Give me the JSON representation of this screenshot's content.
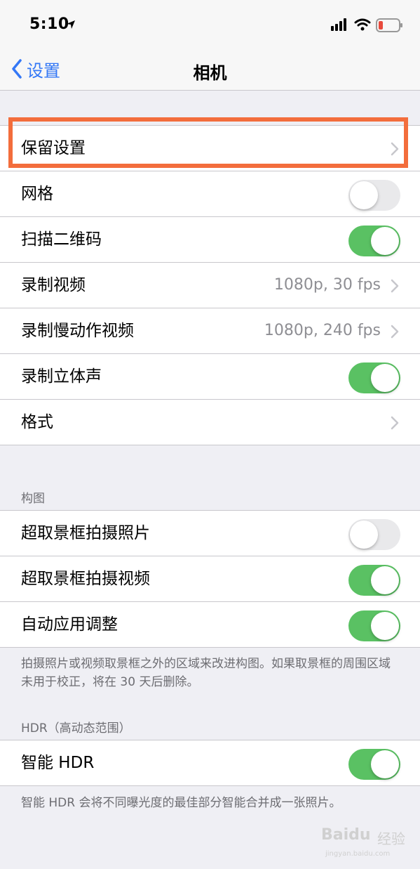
{
  "status_bar": {
    "time": "5:10"
  },
  "nav": {
    "back_label": "设置",
    "title": "相机"
  },
  "group1": {
    "rows": [
      {
        "label": "保留设置",
        "type": "link"
      },
      {
        "label": "网格",
        "type": "toggle",
        "on": false
      },
      {
        "label": "扫描二维码",
        "type": "toggle",
        "on": true
      },
      {
        "label": "录制视频",
        "type": "link",
        "value": "1080p, 30 fps"
      },
      {
        "label": "录制慢动作视频",
        "type": "link",
        "value": "1080p, 240 fps"
      },
      {
        "label": "录制立体声",
        "type": "toggle",
        "on": true
      },
      {
        "label": "格式",
        "type": "link"
      }
    ]
  },
  "composition": {
    "header": "构图",
    "rows": [
      {
        "label": "超取景框拍摄照片",
        "type": "toggle",
        "on": false
      },
      {
        "label": "超取景框拍摄视频",
        "type": "toggle",
        "on": true
      },
      {
        "label": "自动应用调整",
        "type": "toggle",
        "on": true
      }
    ],
    "footer": "拍摄照片或视频取景框之外的区域来改进构图。如果取景框的周围区域未用于校正，将在 30 天后删除。"
  },
  "hdr": {
    "header": "HDR（高动态范围）",
    "rows": [
      {
        "label": "智能 HDR",
        "type": "toggle",
        "on": true
      }
    ],
    "footer": "智能 HDR 会将不同曝光度的最佳部分智能合并成一张照片。"
  },
  "watermark": {
    "brand": "Baidu",
    "text": "经验",
    "url": "jingyan.baidu.com"
  },
  "colors": {
    "accent": "#3478f6",
    "toggle_on": "#5ac163",
    "highlight": "#f36d3c"
  }
}
